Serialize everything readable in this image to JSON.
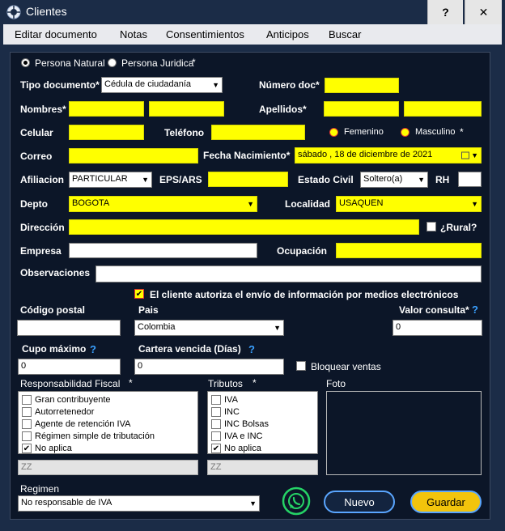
{
  "window": {
    "title": "Clientes",
    "help_label": "?",
    "close_label": "✕"
  },
  "menu": [
    "Editar documento",
    "Notas",
    "Consentimientos",
    "Anticipos",
    "Buscar"
  ],
  "persona": {
    "natural": "Persona Natural",
    "juridica": "Persona Juridica",
    "required": "*",
    "selected": "natural"
  },
  "form": {
    "tipo_doc_label": "Tipo documento*",
    "tipo_doc_value": "Cédula de ciudadanía",
    "numero_doc_label": "Número doc*",
    "nombres_label": "Nombres*",
    "apellidos_label": "Apellidos*",
    "celular_label": "Celular",
    "telefono_label": "Teléfono",
    "femenino_label": "Femenino",
    "masculino_label": "Masculino",
    "sexo_required": "*",
    "correo_label": "Correo",
    "fecha_label": "Fecha Nacimiento*",
    "fecha_value": "sábado  , 18 de  diciembre  de 2021",
    "afiliacion_label": "Afiliacion",
    "afiliacion_value": "PARTICULAR",
    "eps_label": "EPS/ARS",
    "estado_civil_label": "Estado Civil",
    "estado_civil_value": "Soltero(a)",
    "rh_label": "RH",
    "depto_label": "Depto",
    "depto_value": "BOGOTA",
    "localidad_label": "Localidad",
    "localidad_value": "USAQUEN",
    "direccion_label": "Dirección",
    "rural_label": "¿Rural?",
    "empresa_label": "Empresa",
    "ocupacion_label": "Ocupación",
    "observaciones_label": "Observaciones",
    "autoriza_label": "El cliente autoriza el envío de información por medios electrónicos",
    "codigo_postal_label": "Código postal",
    "pais_label": "Pais",
    "pais_value": "Colombia",
    "valor_consulta_label": "Valor consulta*",
    "valor_consulta_value": "0",
    "cupo_label": "Cupo máximo",
    "cupo_value": "0",
    "cartera_label": "Cartera vencida (Días)",
    "cartera_value": "0",
    "bloquear_label": "Bloquear ventas",
    "help_glyph": "?"
  },
  "responsabilidad": {
    "label": "Responsabilidad Fiscal",
    "required": "*",
    "items": [
      {
        "label": "Gran contribuyente",
        "checked": false
      },
      {
        "label": "Autorretenedor",
        "checked": false
      },
      {
        "label": "Agente de retención IVA",
        "checked": false
      },
      {
        "label": "Régimen simple de tributación",
        "checked": false
      },
      {
        "label": "No aplica",
        "checked": true
      }
    ],
    "code": "ZZ"
  },
  "tributos": {
    "label": "Tributos",
    "required": "*",
    "items": [
      {
        "label": "IVA",
        "checked": false
      },
      {
        "label": "INC",
        "checked": false
      },
      {
        "label": "INC Bolsas",
        "checked": false
      },
      {
        "label": "IVA e INC",
        "checked": false
      },
      {
        "label": "No aplica",
        "checked": true
      }
    ],
    "code": "ZZ"
  },
  "foto_label": "Foto",
  "regimen": {
    "label": "Regimen",
    "value": "No responsable de IVA"
  },
  "buttons": {
    "nuevo": "Nuevo",
    "guardar": "Guardar"
  },
  "colors": {
    "highlight": "#ffff00",
    "accent": "#5aa6ff",
    "whatsapp": "#25d366",
    "guardar": "#f2c40c"
  }
}
